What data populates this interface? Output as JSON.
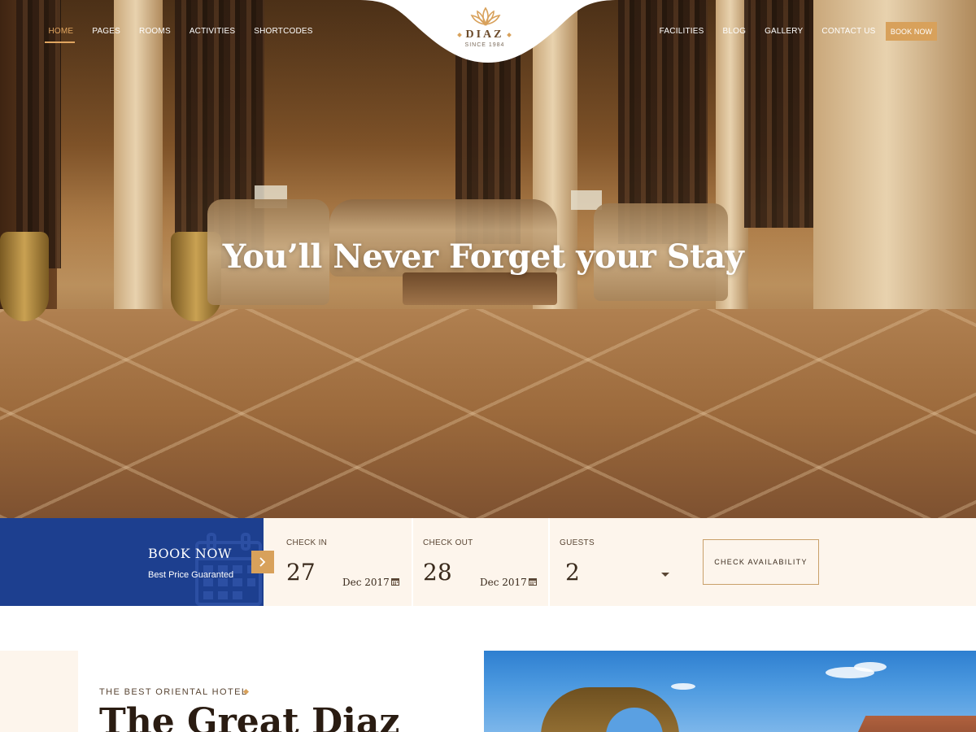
{
  "nav": {
    "left_items": [
      {
        "label": "HOME",
        "active": true
      },
      {
        "label": "PAGES"
      },
      {
        "label": "ROOMS"
      },
      {
        "label": "ACTIVITIES"
      },
      {
        "label": "SHORTCODES"
      }
    ],
    "right_items": [
      {
        "label": "FACILITIES"
      },
      {
        "label": "BLOG"
      },
      {
        "label": "GALLERY"
      },
      {
        "label": "CONTACT US"
      }
    ],
    "book_button": "BOOK NOW"
  },
  "logo": {
    "name": "DIAZ",
    "since": "SINCE 1984"
  },
  "hero": {
    "title_pre": "You’ll ",
    "title_bold": "Never Forget",
    "title_post": " your Stay"
  },
  "booking": {
    "title": "BOOK NOW",
    "subtitle": "Best Price Guaranted",
    "check_in": {
      "label": "CHECK IN",
      "day": "27",
      "month_year": "Dec 2017"
    },
    "check_out": {
      "label": "CHECK OUT",
      "day": "28",
      "month_year": "Dec 2017"
    },
    "guests": {
      "label": "GUESTS",
      "value": "2"
    },
    "check_button": "CHECK AVAILABILITY"
  },
  "about": {
    "kicker": "THE BEST ORIENTAL HOTEL",
    "title": "The Great Diaz"
  },
  "colors": {
    "accent": "#d8a15b",
    "booking_blue": "#1d3f8f",
    "cream": "#fdf5ec"
  },
  "icons": [
    "lotus-logo-icon",
    "calendar-icon",
    "chevron-right-icon",
    "caret-down-icon",
    "diamond-star-icon"
  ]
}
